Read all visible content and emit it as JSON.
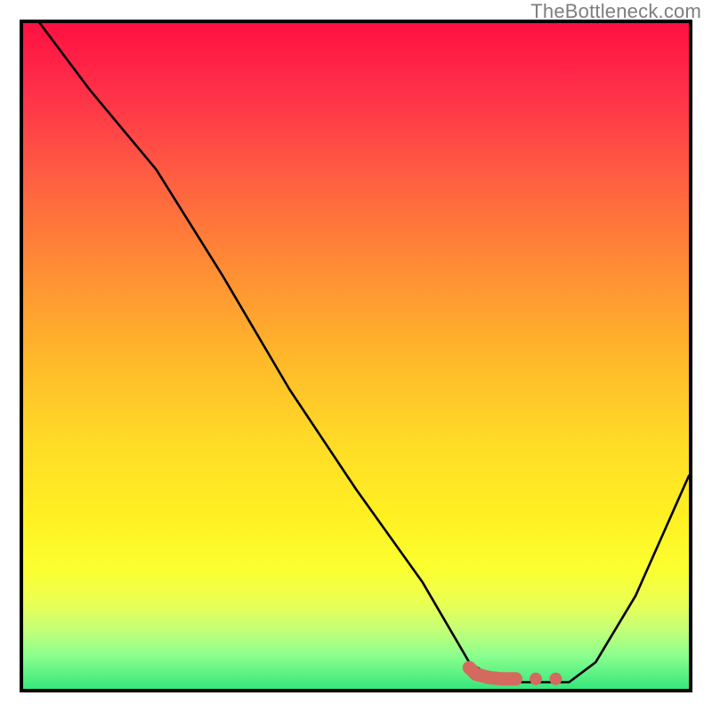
{
  "attribution": "TheBottleneck.com",
  "chart_data": {
    "type": "line",
    "title": "",
    "xlabel": "",
    "ylabel": "",
    "xlim": [
      0,
      100
    ],
    "ylim": [
      0,
      100
    ],
    "series": [
      {
        "name": "bottleneck-curve",
        "x": [
          2.5,
          10,
          20,
          30,
          40,
          50,
          60,
          67,
          70,
          74,
          78,
          82,
          86,
          92,
          100
        ],
        "values": [
          100,
          90,
          78,
          62,
          45,
          30,
          16,
          4,
          2,
          1,
          1,
          1,
          4,
          14,
          32
        ]
      }
    ],
    "markers": {
      "name": "optimal-zone",
      "color": "#d46a5f",
      "points": [
        {
          "x": 67,
          "y": 3.2
        },
        {
          "x": 68,
          "y": 2.2
        },
        {
          "x": 70,
          "y": 1.7
        },
        {
          "x": 72,
          "y": 1.5
        },
        {
          "x": 74,
          "y": 1.5
        },
        {
          "x": 77,
          "y": 1.5
        },
        {
          "x": 80,
          "y": 1.5
        }
      ]
    },
    "gradient_stops": [
      {
        "pos": 0.0,
        "color": "#ff1141"
      },
      {
        "pos": 0.1,
        "color": "#ff2f49"
      },
      {
        "pos": 0.22,
        "color": "#ff5a43"
      },
      {
        "pos": 0.36,
        "color": "#ff8a35"
      },
      {
        "pos": 0.5,
        "color": "#ffb72a"
      },
      {
        "pos": 0.62,
        "color": "#ffd927"
      },
      {
        "pos": 0.74,
        "color": "#fff022"
      },
      {
        "pos": 0.82,
        "color": "#fbff30"
      },
      {
        "pos": 0.87,
        "color": "#eaff52"
      },
      {
        "pos": 0.91,
        "color": "#c6ff76"
      },
      {
        "pos": 0.95,
        "color": "#8bff8f"
      },
      {
        "pos": 1.0,
        "color": "#36e77a"
      }
    ]
  }
}
